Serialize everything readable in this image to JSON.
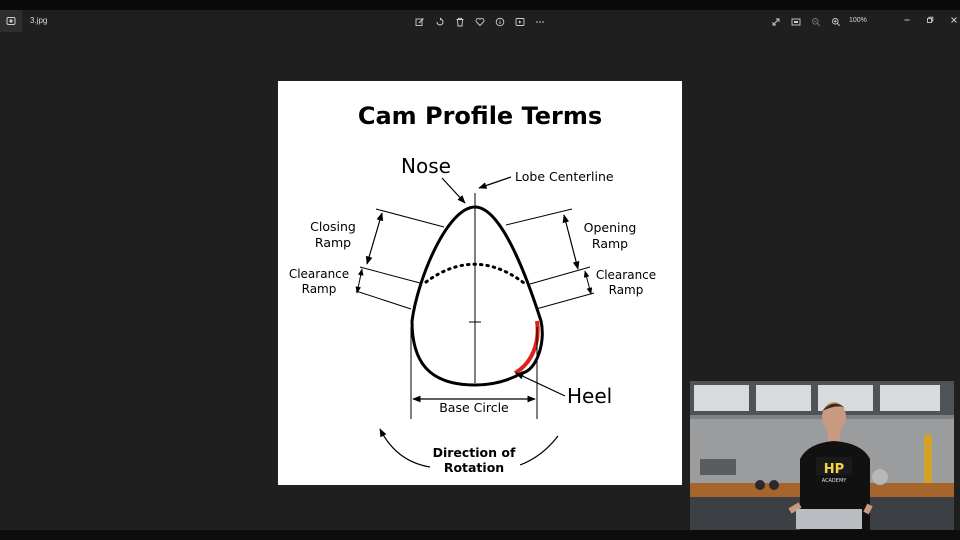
{
  "window": {
    "file_name": "3.jpg",
    "zoom_level": "100%"
  },
  "toolbar": {
    "icons": [
      "edit-icon",
      "rotate-icon",
      "delete-icon",
      "favorite-icon",
      "info-icon",
      "slideshow-icon",
      "more-icon"
    ]
  },
  "view_controls": {
    "icons": [
      "fullscreen-icon",
      "fit-to-window-icon",
      "zoom-out-icon",
      "zoom-in-icon"
    ]
  },
  "window_controls": {
    "icons": [
      "minimize-icon",
      "restore-icon",
      "close-icon"
    ]
  },
  "diagram": {
    "title": "Cam Profile Terms",
    "labels": {
      "nose": "Nose",
      "lobe_centerline": "Lobe Centerline",
      "closing_ramp_1": "Closing",
      "closing_ramp_2": "Ramp",
      "opening_ramp_1": "Opening",
      "opening_ramp_2": "Ramp",
      "clearance_left_1": "Clearance",
      "clearance_left_2": "Ramp",
      "clearance_right_1": "Clearance",
      "clearance_right_2": "Ramp",
      "heel": "Heel",
      "base_circle": "Base Circle",
      "direction_1": "Direction of",
      "direction_2": "Rotation"
    },
    "heel_color": "#e0201a"
  },
  "webcam": {
    "shirt_logo_1": "HP",
    "shirt_logo_2": "ACADEMY"
  }
}
